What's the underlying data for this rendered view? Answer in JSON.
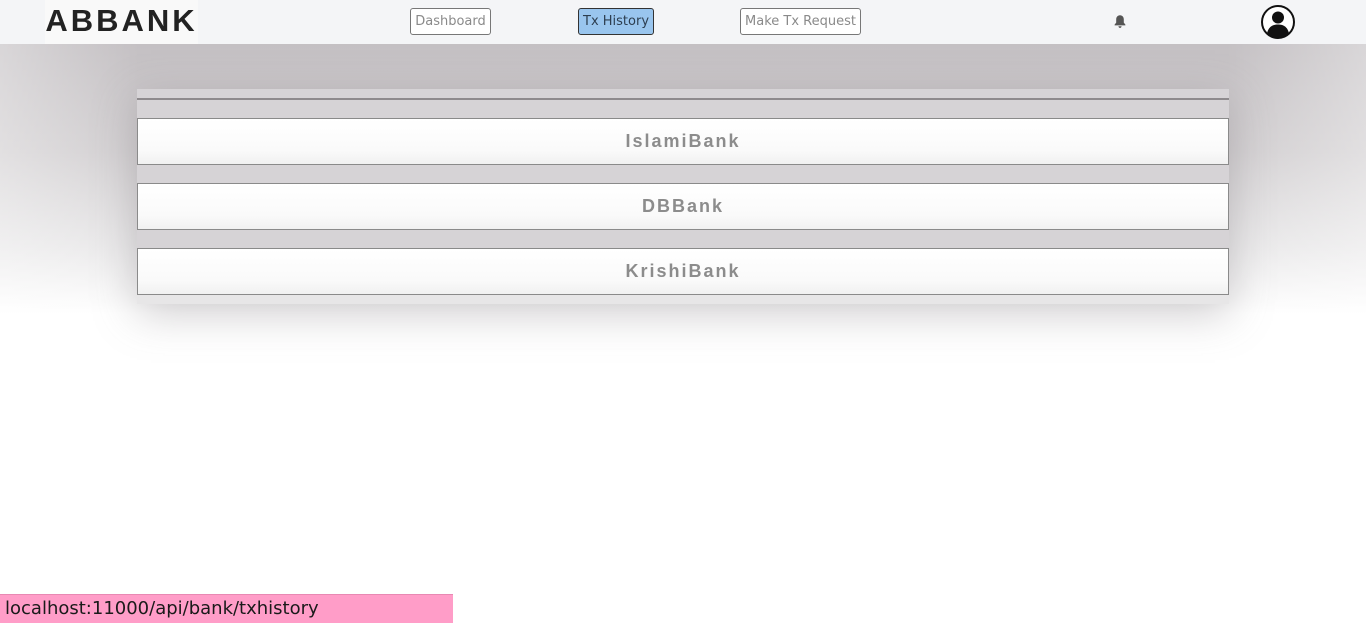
{
  "brand": {
    "name": "ABBANK"
  },
  "nav": {
    "items": [
      {
        "label": "Dashboard",
        "active": false
      },
      {
        "label": "Tx History",
        "active": true
      },
      {
        "label": "Make Tx Request",
        "active": false
      }
    ],
    "icons": {
      "notifications": "bell-icon",
      "account": "user-avatar-icon"
    }
  },
  "banks": [
    {
      "label": "IslamiBank"
    },
    {
      "label": "DBBank"
    },
    {
      "label": "KrishiBank"
    }
  ],
  "status": {
    "url": "localhost:11000/api/bank/txhistory"
  },
  "colors": {
    "active_button": "#99c5ee",
    "status_bar": "#ff9dc8",
    "bank_text": "#8c8c8c"
  }
}
